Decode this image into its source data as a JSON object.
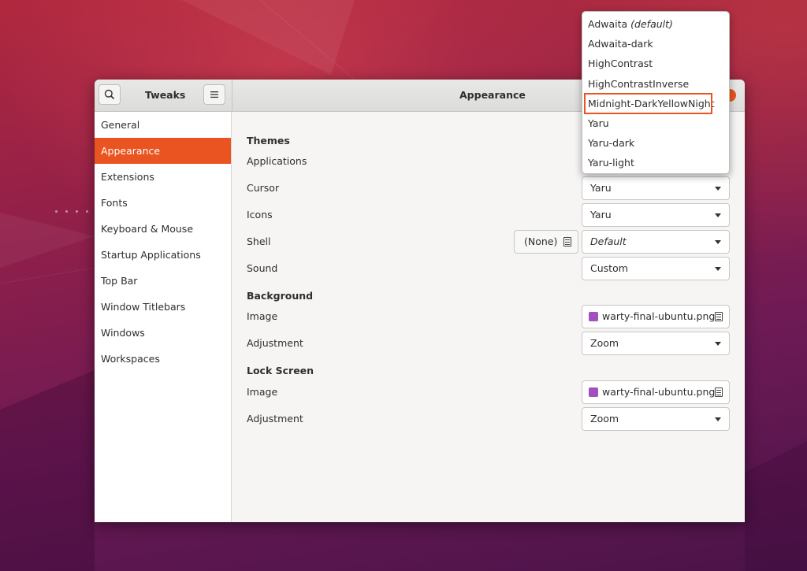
{
  "window": {
    "app_title": "Tweaks",
    "page_title": "Appearance"
  },
  "sidebar": {
    "items": [
      {
        "label": "General"
      },
      {
        "label": "Appearance",
        "active": true
      },
      {
        "label": "Extensions"
      },
      {
        "label": "Fonts"
      },
      {
        "label": "Keyboard & Mouse"
      },
      {
        "label": "Startup Applications"
      },
      {
        "label": "Top Bar"
      },
      {
        "label": "Window Titlebars"
      },
      {
        "label": "Windows"
      },
      {
        "label": "Workspaces"
      }
    ]
  },
  "themes": {
    "heading": "Themes",
    "applications_label": "Applications",
    "cursor_label": "Cursor",
    "cursor_value": "Yaru",
    "icons_label": "Icons",
    "icons_value": "Yaru",
    "shell_label": "Shell",
    "shell_file_button": "(None)",
    "shell_value": "Default",
    "sound_label": "Sound",
    "sound_value": "Custom"
  },
  "background": {
    "heading": "Background",
    "image_label": "Image",
    "image_value": "warty-final-ubuntu.png",
    "adjustment_label": "Adjustment",
    "adjustment_value": "Zoom"
  },
  "lock_screen": {
    "heading": "Lock Screen",
    "image_label": "Image",
    "image_value": "warty-final-ubuntu.png",
    "adjustment_label": "Adjustment",
    "adjustment_value": "Zoom"
  },
  "theme_dropdown": {
    "options": [
      {
        "name": "Adwaita",
        "suffix": "(default)"
      },
      {
        "name": "Adwaita-dark"
      },
      {
        "name": "HighContrast"
      },
      {
        "name": "HighContrastInverse"
      },
      {
        "name": "Midnight-DarkYellowNight",
        "highlighted": true
      },
      {
        "name": "Yaru"
      },
      {
        "name": "Yaru-dark"
      },
      {
        "name": "Yaru-light"
      }
    ]
  },
  "colors": {
    "accent": "#e95420",
    "file_icon": "#a24fc0"
  }
}
